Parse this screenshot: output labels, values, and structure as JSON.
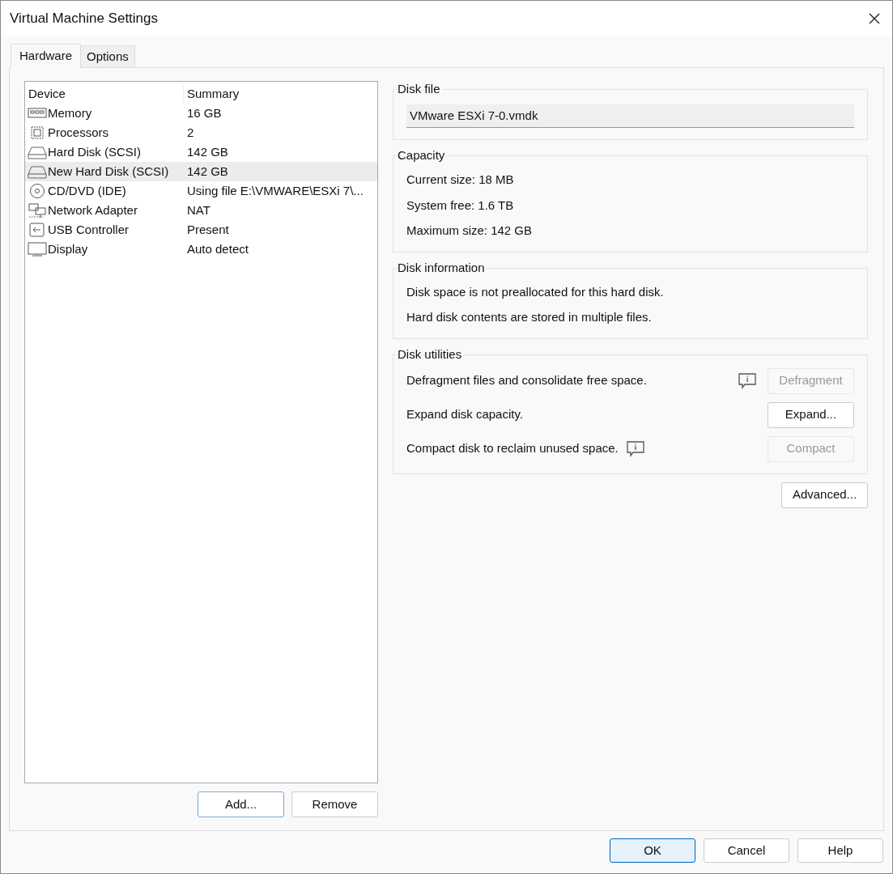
{
  "window": {
    "title": "Virtual Machine Settings"
  },
  "tabs": [
    {
      "label": "Hardware",
      "selected": true
    },
    {
      "label": "Options",
      "selected": false
    }
  ],
  "device_list": {
    "columns": [
      "Device",
      "Summary"
    ],
    "rows": [
      {
        "kind": "memory",
        "device": "Memory",
        "summary": "16 GB",
        "selected": false
      },
      {
        "kind": "processor",
        "device": "Processors",
        "summary": "2",
        "selected": false
      },
      {
        "kind": "disk",
        "device": "Hard Disk (SCSI)",
        "summary": "142 GB",
        "selected": false
      },
      {
        "kind": "disk",
        "device": "New Hard Disk (SCSI)",
        "summary": "142 GB",
        "selected": true
      },
      {
        "kind": "cd",
        "device": "CD/DVD (IDE)",
        "summary": "Using file E:\\VMWARE\\ESXi 7\\...",
        "selected": false
      },
      {
        "kind": "network",
        "device": "Network Adapter",
        "summary": "NAT",
        "selected": false
      },
      {
        "kind": "usb",
        "device": "USB Controller",
        "summary": "Present",
        "selected": false
      },
      {
        "kind": "display",
        "device": "Display",
        "summary": "Auto detect",
        "selected": false
      }
    ]
  },
  "list_buttons": [
    {
      "label": "Add...",
      "disabled": false
    },
    {
      "label": "Remove",
      "disabled": false
    }
  ],
  "disk_file": {
    "title": "Disk file",
    "value": "VMware ESXi 7-0.vmdk"
  },
  "capacity": {
    "title": "Capacity",
    "lines": [
      "Current size: 18 MB",
      "System free: 1.6 TB",
      "Maximum size: 142 GB"
    ]
  },
  "disk_information": {
    "title": "Disk information",
    "lines": [
      "Disk space is not preallocated for this hard disk.",
      "Hard disk contents are stored in multiple files."
    ]
  },
  "disk_utilities": {
    "title": "Disk utilities",
    "items": [
      {
        "text": "Defragment files and consolidate free space.",
        "kind": "hinted",
        "button": "Defragment",
        "disabled": true
      },
      {
        "text": "Expand disk capacity.",
        "kind": "plain",
        "button": "Expand...",
        "disabled": false
      },
      {
        "text": "Compact disk to reclaim unused space.",
        "kind": "annotated",
        "button": "Compact",
        "disabled": true
      }
    ]
  },
  "advanced_button": "Advanced...",
  "footer_buttons": [
    {
      "label": "OK",
      "default": true
    },
    {
      "label": "Cancel",
      "default": false
    },
    {
      "label": "Help",
      "default": false
    }
  ]
}
